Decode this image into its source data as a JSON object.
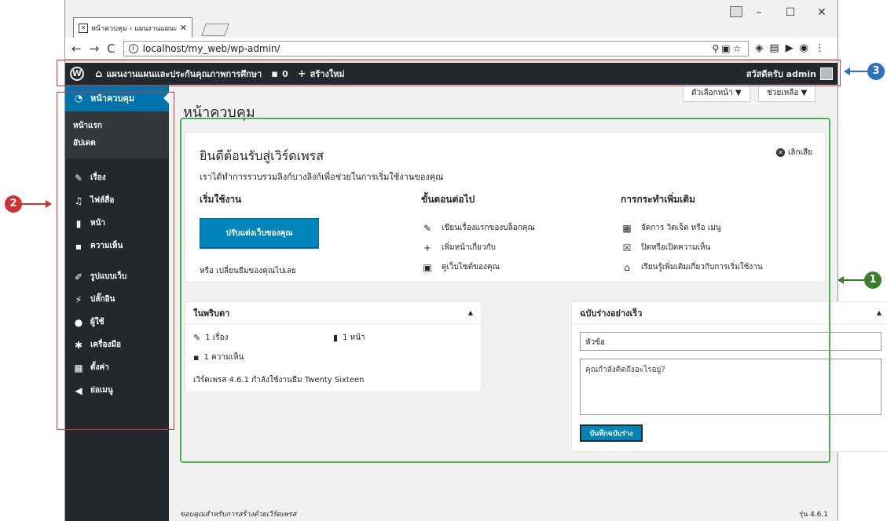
{
  "colors": {
    "admin_bar": "#23282d",
    "menu_active": "#0073aa",
    "primary_button": "#0085ba",
    "callout_1": "#3a7d2c",
    "callout_2": "#d32f2f",
    "callout_3": "#2f6fc1",
    "highlight_red": "#dd3333",
    "highlight_green": "#4caf50"
  },
  "browser": {
    "tab_title": "หน้าควบคุม ‹ แผนงานแผนแ",
    "tab_close": "✕",
    "url": "localhost/my_web/wp-admin/",
    "window_controls": [
      "–",
      "☐",
      "✕"
    ]
  },
  "adminbar": {
    "site_name": "แผนงานแผนและประกันคุณภาพการศึกษา",
    "comments_count": "0",
    "new_label": "สร้างใหม่",
    "greeting": "สวัสดีครับ admin"
  },
  "sidebar": {
    "dashboard": "หน้าควบคุม",
    "submenu": [
      "หน้าแรก",
      "อัปเดต"
    ],
    "items": [
      {
        "label": "เรื่อง",
        "icon": "pin-icon"
      },
      {
        "label": "ไฟล์สื่อ",
        "icon": "media-icon"
      },
      {
        "label": "หน้า",
        "icon": "page-icon"
      },
      {
        "label": "ความเห็น",
        "icon": "comment-icon"
      },
      {
        "label": "รูปแบบเว็บ",
        "icon": "brush-icon"
      },
      {
        "label": "ปลั๊กอิน",
        "icon": "plugin-icon"
      },
      {
        "label": "ผู้ใช้",
        "icon": "user-icon"
      },
      {
        "label": "เครื่องมือ",
        "icon": "wrench-icon"
      },
      {
        "label": "ตั้งค่า",
        "icon": "settings-icon"
      },
      {
        "label": "ย่อเมนู",
        "icon": "collapse-icon"
      }
    ]
  },
  "main": {
    "title": "หน้าควบคุม",
    "screen_options": "ตัวเลือกหน้า ▼",
    "help": "ช่วยเหลือ ▼",
    "welcome": {
      "heading": "ยินดีต้อนรับสู่เวิร์ดเพรส",
      "subheading": "เราได้ทำการรวบรวมลิงก์บางลิงก์เพื่อช่วยในการเริ่มใช้งานของคุณ",
      "dismiss": "เลิกเสีย",
      "col1_title": "เริ่มใช้งาน",
      "customize_button": "ปรับแต่งเว็บของคุณ",
      "or_change_theme": "หรือ เปลี่ยนธีมของคุณไปเลย",
      "col2_title": "ขั้นตอนต่อไป",
      "next_steps": [
        "เขียนเรื่องแรกของบล็อกคุณ",
        "เพิ่มหน้าเกี่ยวกับ",
        "ดูเว็บไซต์ของคุณ"
      ],
      "col3_title": "การกระทำเพิ่มเติม",
      "more_actions": [
        "จัดการ วิดเจ็ต หรือ เมนู",
        "ปิดหรือเปิดความเห็น",
        "เรียนรู้เพิ่มเติมเกี่ยวกับการเริ่มใช้งาน"
      ]
    },
    "glance": {
      "title": "ในพริบตา",
      "posts": "1 เรื่อง",
      "pages": "1 หน้า",
      "comments": "1 ความเห็น",
      "version_text": "เวิร์ดเพรส 4.6.1 กำลังใช้งานธีม Twenty Sixteen"
    },
    "quick_draft": {
      "title": "ฉบับร่างอย่างเร็ว",
      "title_placeholder": "หัวข้อ",
      "content_placeholder": "คุณกำลังคิดถึงอะไรอยู่?",
      "save_button": "บันทึกฉบับร่าง"
    },
    "footer": {
      "thanks": "ขอบคุณสำหรับการสร้างด้วยเวิร์ดเพรส",
      "version": "รุ่น 4.6.1"
    }
  },
  "annotations": [
    "1",
    "2",
    "3"
  ]
}
